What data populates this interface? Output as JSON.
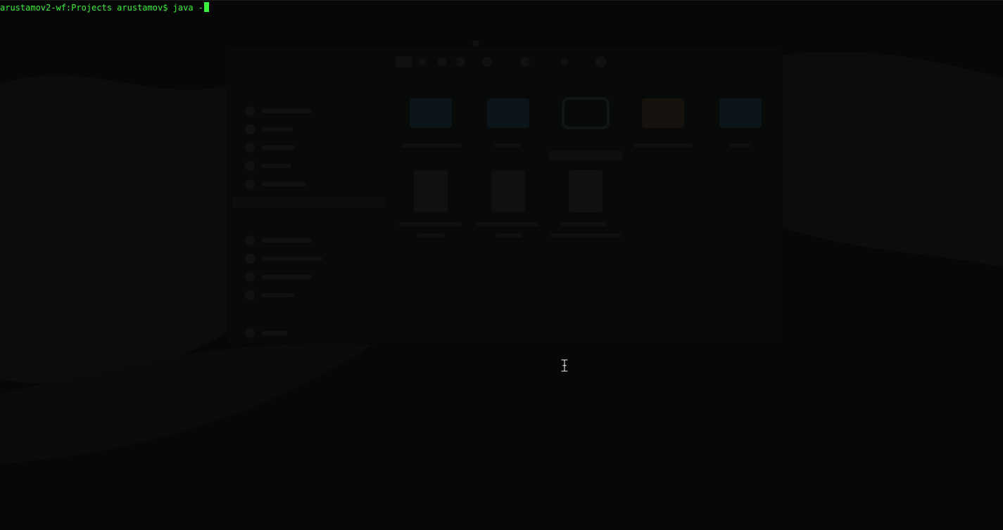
{
  "terminal": {
    "prompt": "arustamov2-wf:Projects arustamov$ ",
    "command": "java -",
    "colors": {
      "background": "#060707",
      "foreground": "#3cf03c"
    }
  },
  "pointer": {
    "icon": "ibeam-cursor-icon"
  }
}
